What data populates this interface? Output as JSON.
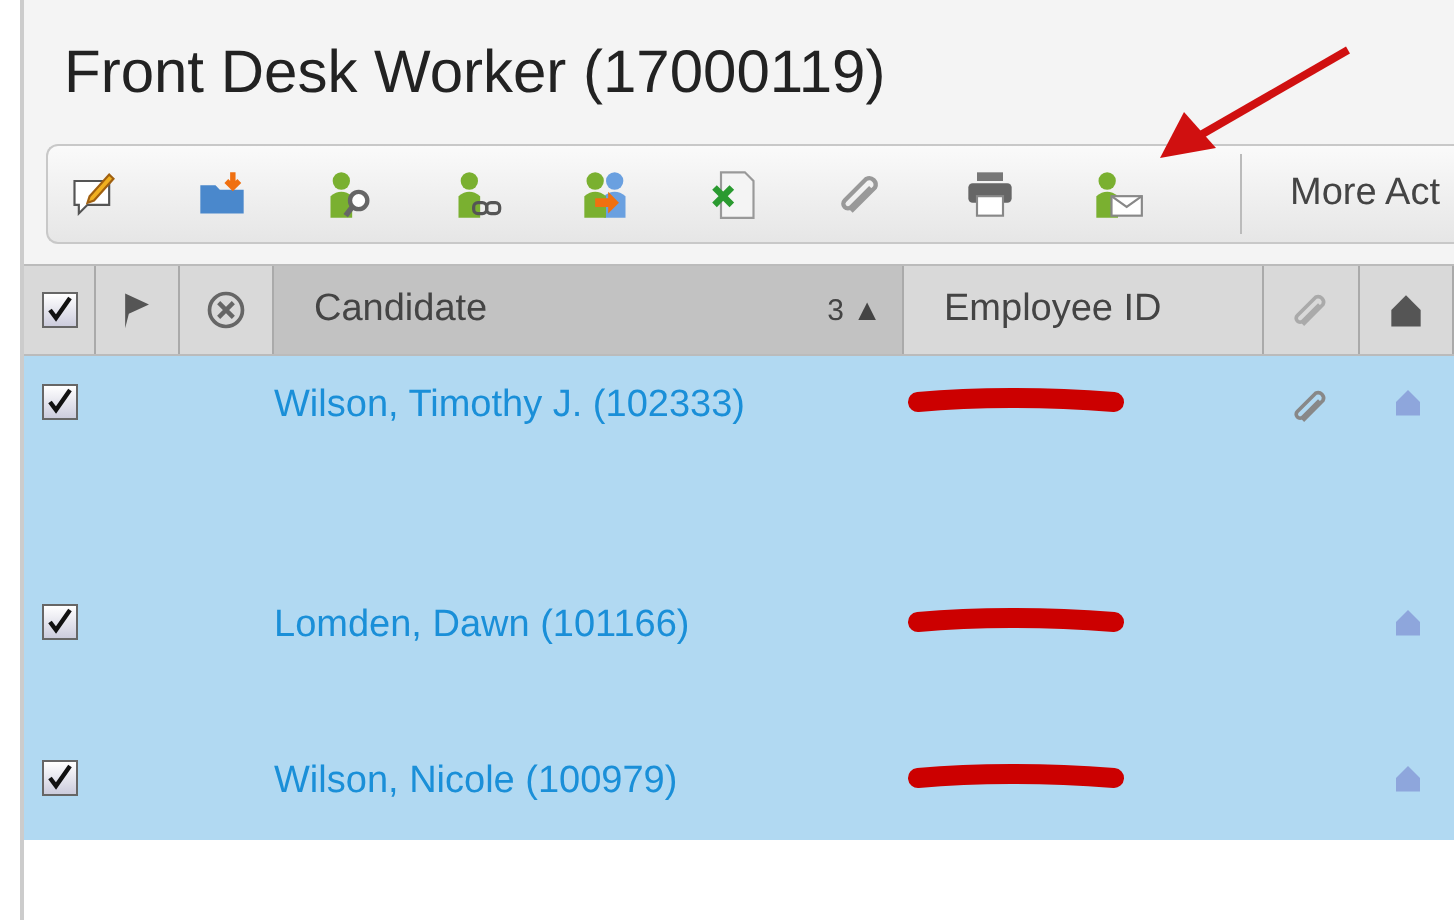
{
  "title": "Front Desk Worker (17000119)",
  "toolbar": {
    "tools": [
      {
        "kind": "note"
      },
      {
        "kind": "folder"
      },
      {
        "kind": "person-search"
      },
      {
        "kind": "person-link"
      },
      {
        "kind": "person-transfer"
      },
      {
        "kind": "excel"
      },
      {
        "kind": "clip"
      },
      {
        "kind": "print"
      },
      {
        "kind": "person-mail"
      }
    ],
    "more": "More Act"
  },
  "table": {
    "select_all": {
      "checked": true
    },
    "columns": [
      {
        "kind": "check"
      },
      {
        "kind": "flag"
      },
      {
        "kind": "cancel"
      },
      {
        "kind": "text",
        "label": "Candidate",
        "sort": "3 ▲",
        "selected": true
      },
      {
        "kind": "text",
        "label": "Employee ID",
        "selected": false
      },
      {
        "kind": "clip"
      },
      {
        "kind": "home"
      }
    ],
    "rows": [
      {
        "checked": true,
        "candidate": "Wilson, Timothy J. (102333)",
        "employee_id_redacted": true,
        "attachment": true
      },
      {
        "checked": true,
        "candidate": "Lomden, Dawn (101166)",
        "employee_id_redacted": true,
        "attachment": false
      },
      {
        "checked": true,
        "candidate": "Wilson, Nicole (100979)",
        "employee_id_redacted": true,
        "attachment": false
      }
    ]
  }
}
